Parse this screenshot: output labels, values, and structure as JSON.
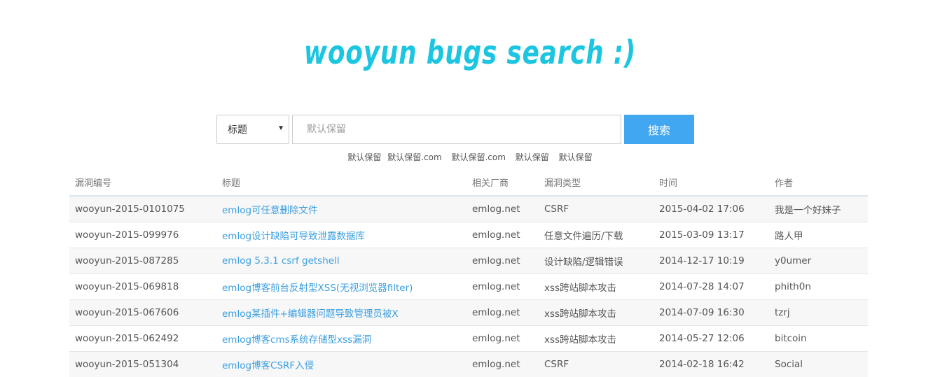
{
  "logo": "wooyun bugs search :)",
  "search": {
    "select_value": "标题",
    "placeholder": "默认保留",
    "button_label": "搜索"
  },
  "hints": [
    "默认保留",
    "默认保留.com",
    "默认保留.com",
    "默认保留",
    "默认保留"
  ],
  "table": {
    "headers": [
      "漏洞编号",
      "标题",
      "相关厂商",
      "漏洞类型",
      "时间",
      "作者"
    ],
    "rows": [
      [
        "wooyun-2015-0101075",
        "emlog可任意删除文件",
        "emlog.net",
        "CSRF",
        "2015-04-02 17:06",
        "我是一个好妹子"
      ],
      [
        "wooyun-2015-099976",
        "emlog设计缺陷可导致泄露数据库",
        "emlog.net",
        "任意文件遍历/下载",
        "2015-03-09 13:17",
        "路人甲"
      ],
      [
        "wooyun-2015-087285",
        "emlog 5.3.1 csrf getshell",
        "emlog.net",
        "设计缺陷/逻辑错误",
        "2014-12-17 10:19",
        "y0umer"
      ],
      [
        "wooyun-2015-069818",
        "emlog博客前台反射型XSS(无视浏览器filter)",
        "emlog.net",
        "xss跨站脚本攻击",
        "2014-07-28 14:07",
        "phith0n"
      ],
      [
        "wooyun-2015-067606",
        "emlog某插件+编辑器问题导致管理员被X",
        "emlog.net",
        "xss跨站脚本攻击",
        "2014-07-09 16:30",
        "tzrj"
      ],
      [
        "wooyun-2015-062492",
        "emlog博客cms系统存储型xss漏洞",
        "emlog.net",
        "xss跨站脚本攻击",
        "2014-05-27 12:06",
        "bitcoin"
      ],
      [
        "wooyun-2015-051304",
        "emlog博客CSRF入侵",
        "emlog.net",
        "CSRF",
        "2014-02-18 16:42",
        "Social"
      ]
    ]
  }
}
